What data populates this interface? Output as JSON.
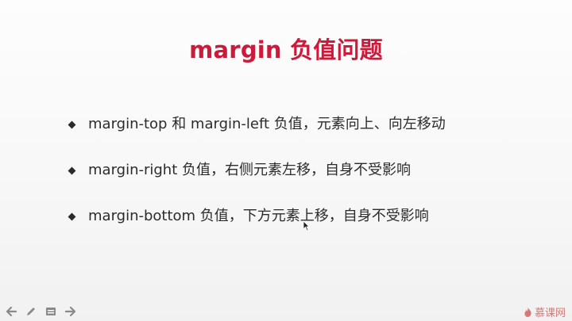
{
  "slide": {
    "title": "margin 负值问题",
    "bullets": [
      "margin-top 和 margin-left 负值，元素向上、向左移动",
      "margin-right 负值，右侧元素左移，自身不受影响",
      "margin-bottom 负值，下方元素上移，自身不受影响"
    ]
  },
  "controls": {
    "icons": [
      "prev-arrow-icon",
      "pen-icon",
      "menu-icon",
      "next-arrow-icon"
    ]
  },
  "logo": {
    "text": "慕课网",
    "icon": "flame-icon"
  },
  "colors": {
    "title": "#cc1a3a",
    "text": "#2b2b2b",
    "logo": "#d27878"
  }
}
